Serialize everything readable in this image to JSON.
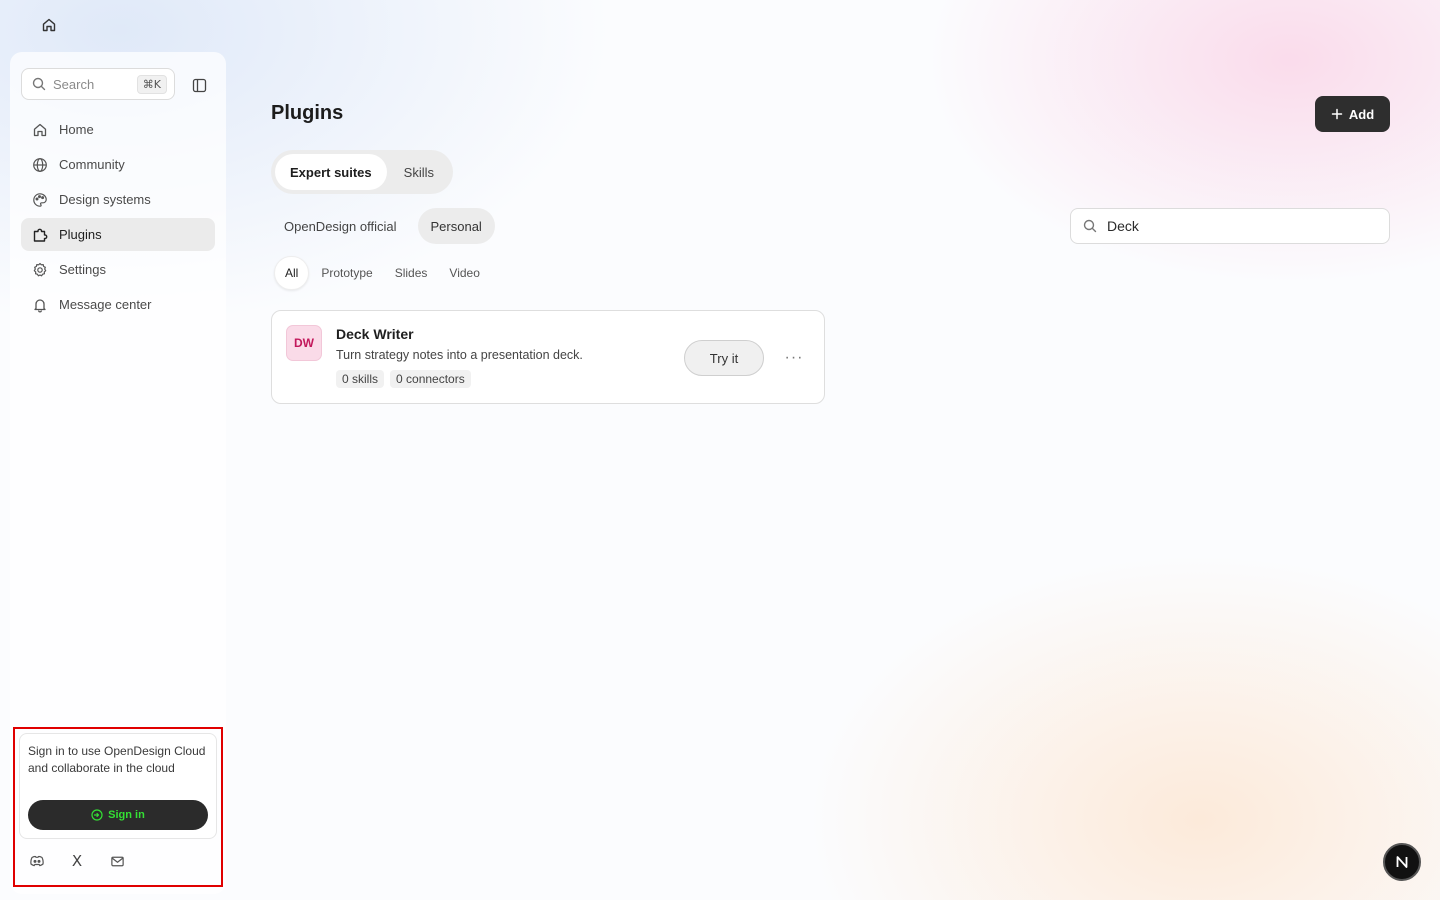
{
  "sidebar": {
    "search": {
      "placeholder": "Search",
      "shortcut": "⌘K"
    },
    "items": [
      {
        "label": "Home",
        "icon": "home-icon",
        "active": false
      },
      {
        "label": "Community",
        "icon": "globe-icon",
        "active": false
      },
      {
        "label": "Design systems",
        "icon": "palette-icon",
        "active": false
      },
      {
        "label": "Plugins",
        "icon": "puzzle-icon",
        "active": true
      },
      {
        "label": "Settings",
        "icon": "gear-icon",
        "active": false
      },
      {
        "label": "Message center",
        "icon": "bell-icon",
        "active": false
      }
    ],
    "signin": {
      "message": "Sign in to use OpenDesign Cloud and collaborate in the cloud",
      "button_label": "Sign in"
    },
    "social": {
      "x_label": "X"
    }
  },
  "main": {
    "title": "Plugins",
    "add_label": "Add",
    "suite_tabs": [
      {
        "label": "Expert suites",
        "active": true
      },
      {
        "label": "Skills",
        "active": false
      }
    ],
    "source_tabs": [
      {
        "label": "OpenDesign official",
        "active": false
      },
      {
        "label": "Personal",
        "active": true
      }
    ],
    "category_tabs": [
      {
        "label": "All",
        "active": true
      },
      {
        "label": "Prototype",
        "active": false
      },
      {
        "label": "Slides",
        "active": false
      },
      {
        "label": "Video",
        "active": false
      }
    ],
    "filter": {
      "value": "Deck"
    },
    "plugins": [
      {
        "initials": "DW",
        "name": "Deck Writer",
        "description": "Turn strategy notes into a presentation deck.",
        "skills": "0 skills",
        "connectors": "0 connectors",
        "try_label": "Try it",
        "more_label": "···"
      }
    ]
  },
  "badge": {
    "letter": "N"
  },
  "colors": {
    "accent_dark": "#2e2e2e",
    "signin_text": "#34e034",
    "avatar_bg": "#fadbe8",
    "avatar_text": "#c2185b",
    "highlight_outline": "#e00000"
  }
}
